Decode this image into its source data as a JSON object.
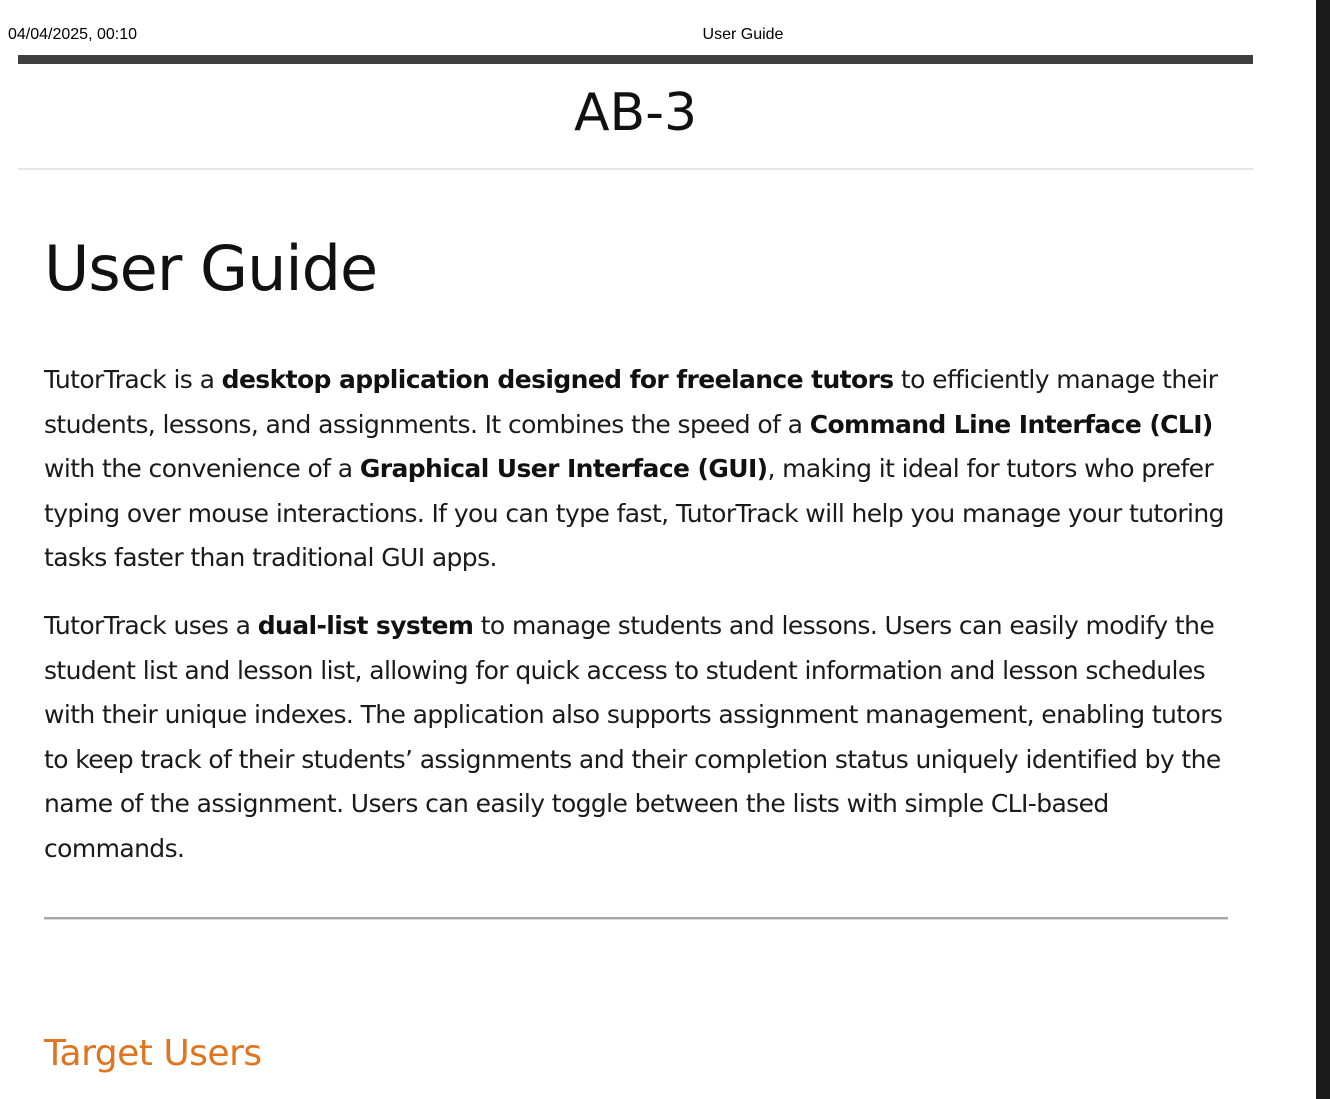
{
  "print_header": {
    "datetime": "04/04/2025, 00:10",
    "title": "User Guide"
  },
  "site": {
    "title": "AB-3"
  },
  "page": {
    "heading": "User Guide",
    "intro": [
      {
        "text": "TutorTrack is a ",
        "bold": false
      },
      {
        "text": "desktop application designed for freelance tutors",
        "bold": true
      },
      {
        "text": " to efficiently manage their students, lessons, and assignments. It combines the speed of a ",
        "bold": false
      },
      {
        "text": "Command Line Interface (CLI)",
        "bold": true
      },
      {
        "text": " with the convenience of a ",
        "bold": false
      },
      {
        "text": "Graphical User Interface (GUI)",
        "bold": true
      },
      {
        "text": ", making it ideal for tutors who prefer typing over mouse interactions. If you can type fast, TutorTrack will help you manage your tutoring tasks faster than traditional GUI apps.",
        "bold": false
      }
    ],
    "dual_list": [
      {
        "text": "TutorTrack uses a ",
        "bold": false
      },
      {
        "text": "dual-list system",
        "bold": true
      },
      {
        "text": " to manage students and lessons. Users can easily modify the student list and lesson list, allowing for quick access to student information and lesson schedules with their unique indexes. The application also supports assignment management, enabling tutors to keep track of their students’ assignments and their completion status uniquely identified by the name of the assignment. Users can easily toggle between the lists with simple CLI-based commands.",
        "bold": false
      }
    ],
    "section_heading": "Target Users"
  },
  "colors": {
    "section_heading": "#e0741f",
    "top_bar": "#3f3f3f"
  }
}
